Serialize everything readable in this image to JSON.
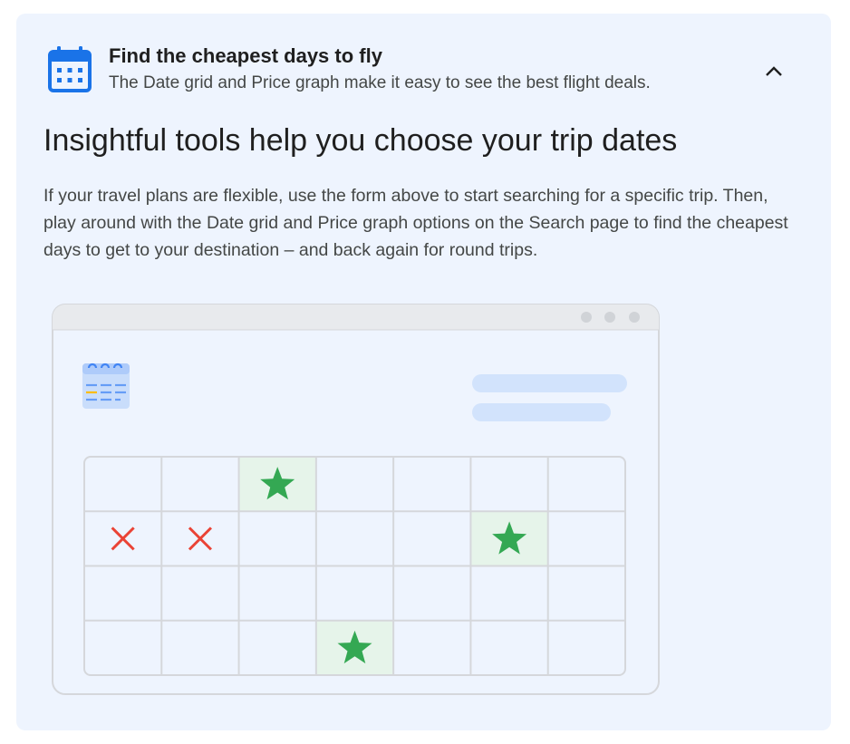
{
  "section": {
    "title": "Find the cheapest days to fly",
    "subtitle": "The Date grid and Price graph make it easy to see the best flight deals.",
    "collapse_icon": "chevron-up-icon"
  },
  "main": {
    "heading": "Insightful tools help you choose your trip dates",
    "description": "If your travel plans are flexible, use the form above to start searching for a specific trip. Then, play around with the Date grid and Price graph options on the Search page to find the cheapest days to get to your destination – and back again for round trips."
  },
  "illustration": {
    "grid_rows": 4,
    "grid_cols": 7,
    "best_days": [
      [
        0,
        2
      ],
      [
        1,
        5
      ],
      [
        3,
        3
      ]
    ],
    "unavailable_days": [
      [
        1,
        0
      ],
      [
        1,
        1
      ]
    ],
    "colors": {
      "card_background": "#eef4fe",
      "accent_blue": "#1a73e8",
      "star_green": "#34a853",
      "highlight_green": "#e6f4ea",
      "x_red": "#ea4335",
      "grid_line": "#d5d7db",
      "placeholder_bar": "#d2e3fc"
    }
  }
}
